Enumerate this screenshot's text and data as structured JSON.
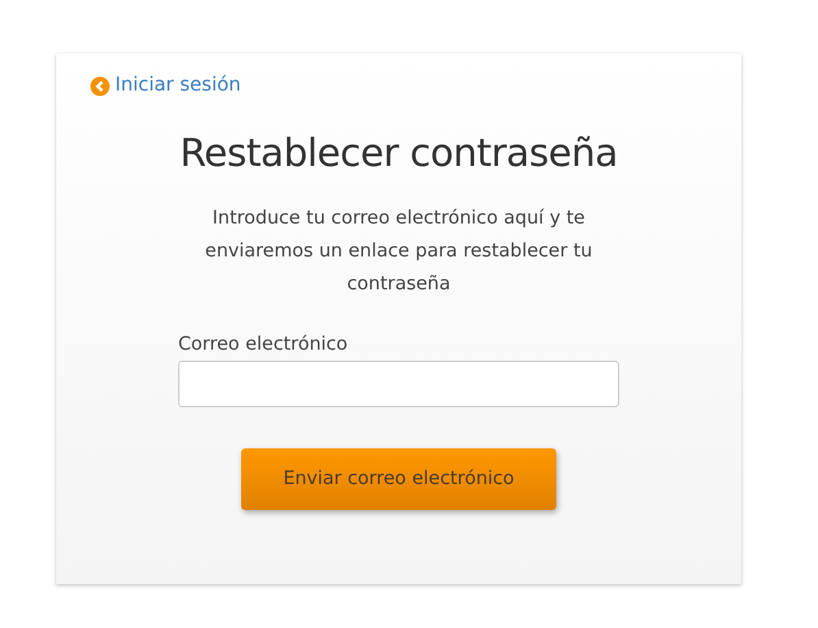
{
  "back_link": {
    "label": "Iniciar sesión"
  },
  "title": "Restablecer contraseña",
  "description": "Introduce tu correo electrónico aquí y te enviaremos un enlace para restablecer tu contraseña",
  "email_field": {
    "label": "Correo electrónico"
  },
  "submit_button": {
    "label": "Enviar correo electrónico"
  }
}
